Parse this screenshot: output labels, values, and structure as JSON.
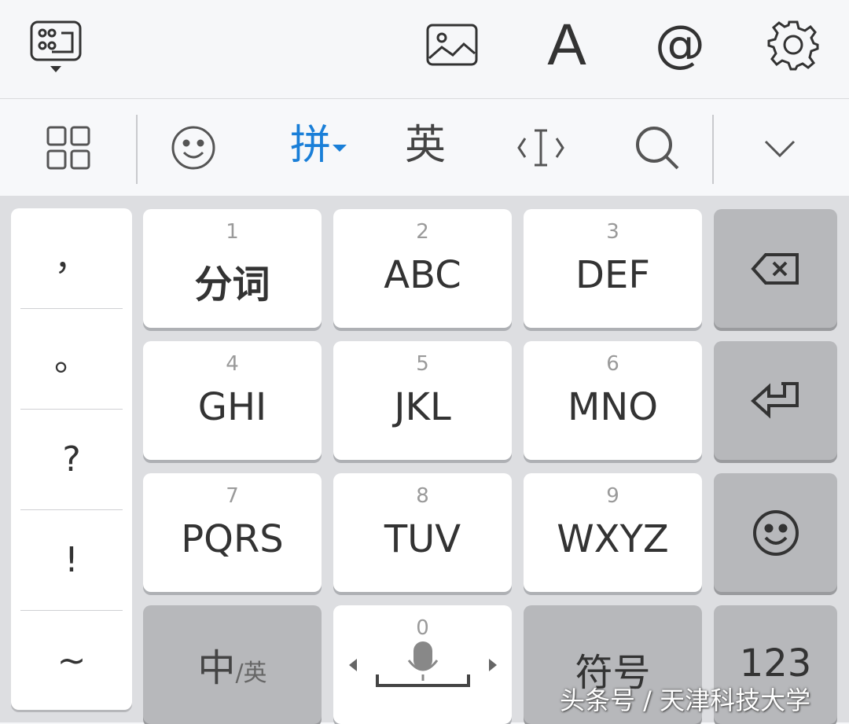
{
  "top_bar": {
    "icons": [
      "keyboard-layout-icon",
      "image-icon",
      "font-icon",
      "at-icon",
      "gear-icon"
    ],
    "font_label": "A",
    "at_label": "@"
  },
  "toolbar": {
    "pinyin_label": "拼",
    "english_label": "英",
    "active_color": "#1a7fd8"
  },
  "punctuation": [
    "，",
    "。",
    "?",
    "!",
    "~"
  ],
  "keys": {
    "row1": [
      {
        "num": "1",
        "label": "分词"
      },
      {
        "num": "2",
        "label": "ABC"
      },
      {
        "num": "3",
        "label": "DEF"
      }
    ],
    "row2": [
      {
        "num": "4",
        "label": "GHI"
      },
      {
        "num": "5",
        "label": "JKL"
      },
      {
        "num": "6",
        "label": "MNO"
      }
    ],
    "row3": [
      {
        "num": "7",
        "label": "PQRS"
      },
      {
        "num": "8",
        "label": "TUV"
      },
      {
        "num": "9",
        "label": "WXYZ"
      }
    ],
    "bottom": {
      "lang_main": "中",
      "lang_sub": "/英",
      "space_num": "0",
      "symbol_label": "符号",
      "num_label": "123"
    }
  },
  "watermark": "头条号 / 天津科技大学"
}
